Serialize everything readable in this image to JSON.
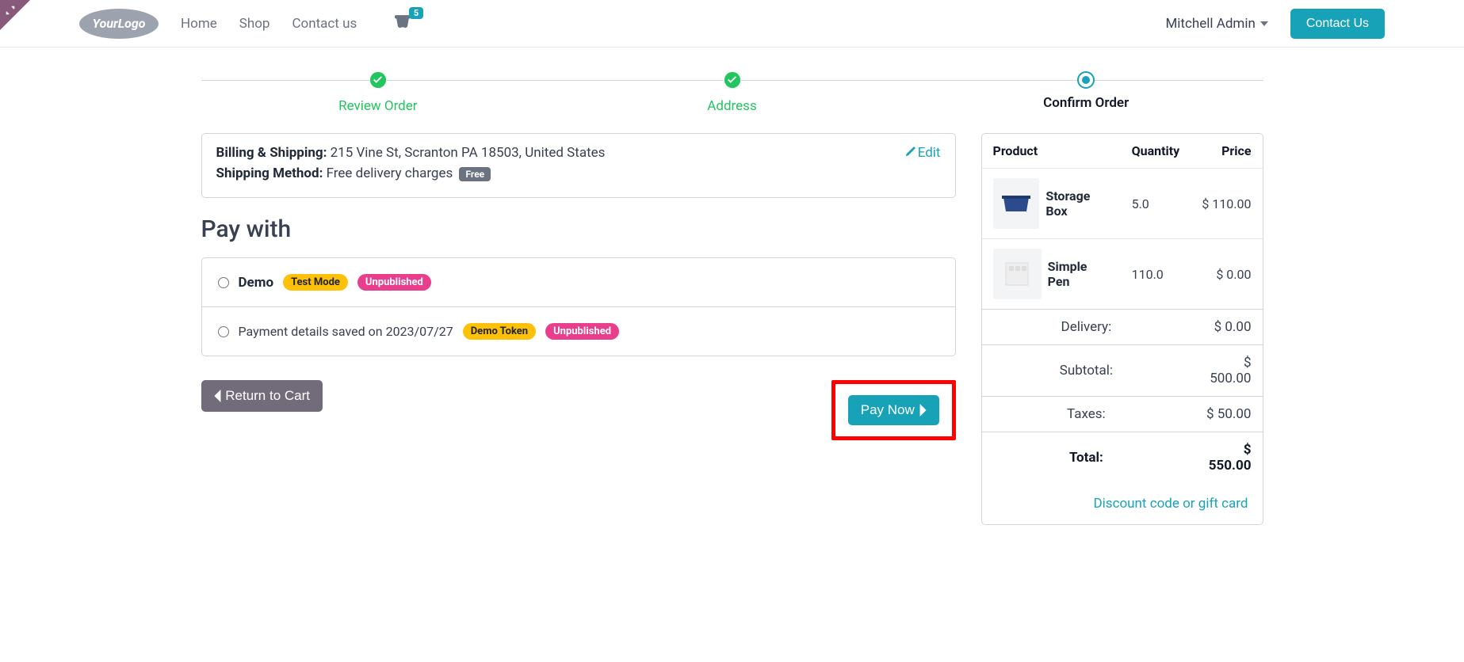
{
  "nav": {
    "logo_text": "YourLogo",
    "home": "Home",
    "shop": "Shop",
    "contact": "Contact us",
    "cart_count": "5",
    "user": "Mitchell Admin",
    "contact_btn": "Contact Us"
  },
  "steps": {
    "review": "Review Order",
    "address": "Address",
    "confirm": "Confirm Order"
  },
  "shipping": {
    "billing_label": "Billing & Shipping:",
    "billing_address": "215 Vine St, Scranton PA 18503, United States",
    "edit": "Edit",
    "method_label": "Shipping Method:",
    "method_value": "Free delivery charges",
    "free_badge": "Free"
  },
  "pay": {
    "title": "Pay with",
    "demo_label": "Demo",
    "test_mode": "Test Mode",
    "unpublished": "Unpublished",
    "saved_label": "Payment details saved on 2023/07/27",
    "demo_token": "Demo Token"
  },
  "actions": {
    "return": "Return to Cart",
    "pay_now": "Pay Now"
  },
  "summary": {
    "hdr_product": "Product",
    "hdr_qty": "Quantity",
    "hdr_price": "Price",
    "items": [
      {
        "name": "Storage Box",
        "qty": "5.0",
        "price": "$ 110.00"
      },
      {
        "name": "Simple Pen",
        "qty": "110.0",
        "price": "$ 0.00"
      }
    ],
    "delivery_lbl": "Delivery:",
    "delivery_val": "$ 0.00",
    "subtotal_lbl": "Subtotal:",
    "subtotal_val": "$ 500.00",
    "taxes_lbl": "Taxes:",
    "taxes_val": "$ 50.00",
    "total_lbl": "Total:",
    "total_val": "$ 550.00",
    "discount_link": "Discount code or gift card"
  }
}
